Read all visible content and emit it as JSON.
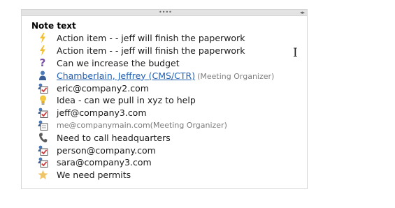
{
  "panel": {
    "heading": "Note text",
    "grip": "••••",
    "arrows": "◂▸"
  },
  "items": [
    {
      "icon": "lightning-bolt-icon",
      "text": "Action item - - jeff will finish the paperwork"
    },
    {
      "icon": "lightning-bolt-icon",
      "text": "Action item - - jeff will finish the paperwork"
    },
    {
      "icon": "question-mark-icon",
      "text": "Can we increase the budget"
    },
    {
      "icon": "person-icon",
      "link": "Chamberlain, Jeffrey (CMS/CTR)",
      "suffix": "(Meeting Organizer)"
    },
    {
      "icon": "attendee-check-icon",
      "text": "eric@company2.com"
    },
    {
      "icon": "lightbulb-icon",
      "text": "Idea - can we pull in xyz to help"
    },
    {
      "icon": "attendee-check-icon",
      "text": "jeff@company3.com"
    },
    {
      "icon": "attendee-icon",
      "text": "me@companymain.com(Meeting Organizer)"
    },
    {
      "icon": "phone-icon",
      "text": "Need to call headquarters"
    },
    {
      "icon": "attendee-check-icon",
      "text": "person@company.com"
    },
    {
      "icon": "attendee-check-icon",
      "text": "sara@company3.com"
    },
    {
      "icon": "star-icon",
      "text": "We need permits"
    }
  ],
  "colors": {
    "bolt": "#f2c033",
    "question": "#7b4fa8",
    "link": "#1f5fb4",
    "check": "#d23a3a",
    "star": "#f0c56a"
  }
}
